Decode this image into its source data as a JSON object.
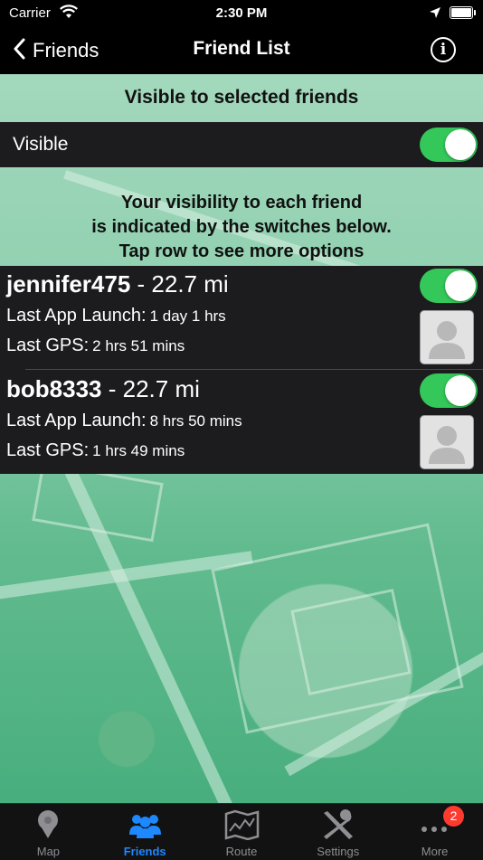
{
  "status_bar": {
    "carrier": "Carrier",
    "time": "2:30 PM"
  },
  "nav": {
    "back_label": "Friends",
    "title": "Friend List"
  },
  "banner": {
    "text": "Visible to selected friends"
  },
  "visible_row": {
    "label": "Visible",
    "on": true
  },
  "info_text": {
    "line1": "Your visibility to each friend",
    "line2": "is indicated by the switches below.",
    "line3": "Tap row to see more options"
  },
  "friends": [
    {
      "name": "jennifer475",
      "distance": "- 22.7 mi",
      "launch_label": "Last App Launch:",
      "launch_value": "1 day 1 hrs",
      "gps_label": "Last GPS:",
      "gps_value": "2 hrs 51 mins",
      "visible": true
    },
    {
      "name": "bob8333",
      "distance": "- 22.7 mi",
      "launch_label": "Last App Launch:",
      "launch_value": "8 hrs 50 mins",
      "gps_label": "Last GPS:",
      "gps_value": "1 hrs 49 mins",
      "visible": true
    }
  ],
  "tabs": [
    {
      "label": "Map",
      "icon": "map-pin-icon",
      "active": false
    },
    {
      "label": "Friends",
      "icon": "friends-icon",
      "active": true
    },
    {
      "label": "Route",
      "icon": "route-map-icon",
      "active": false
    },
    {
      "label": "Settings",
      "icon": "settings-tools-icon",
      "active": false
    },
    {
      "label": "More",
      "icon": "more-dots-icon",
      "active": false,
      "badge": "2"
    }
  ],
  "colors": {
    "switch_on": "#34c759",
    "tab_active": "#1e88ff",
    "badge": "#ff3b30"
  }
}
